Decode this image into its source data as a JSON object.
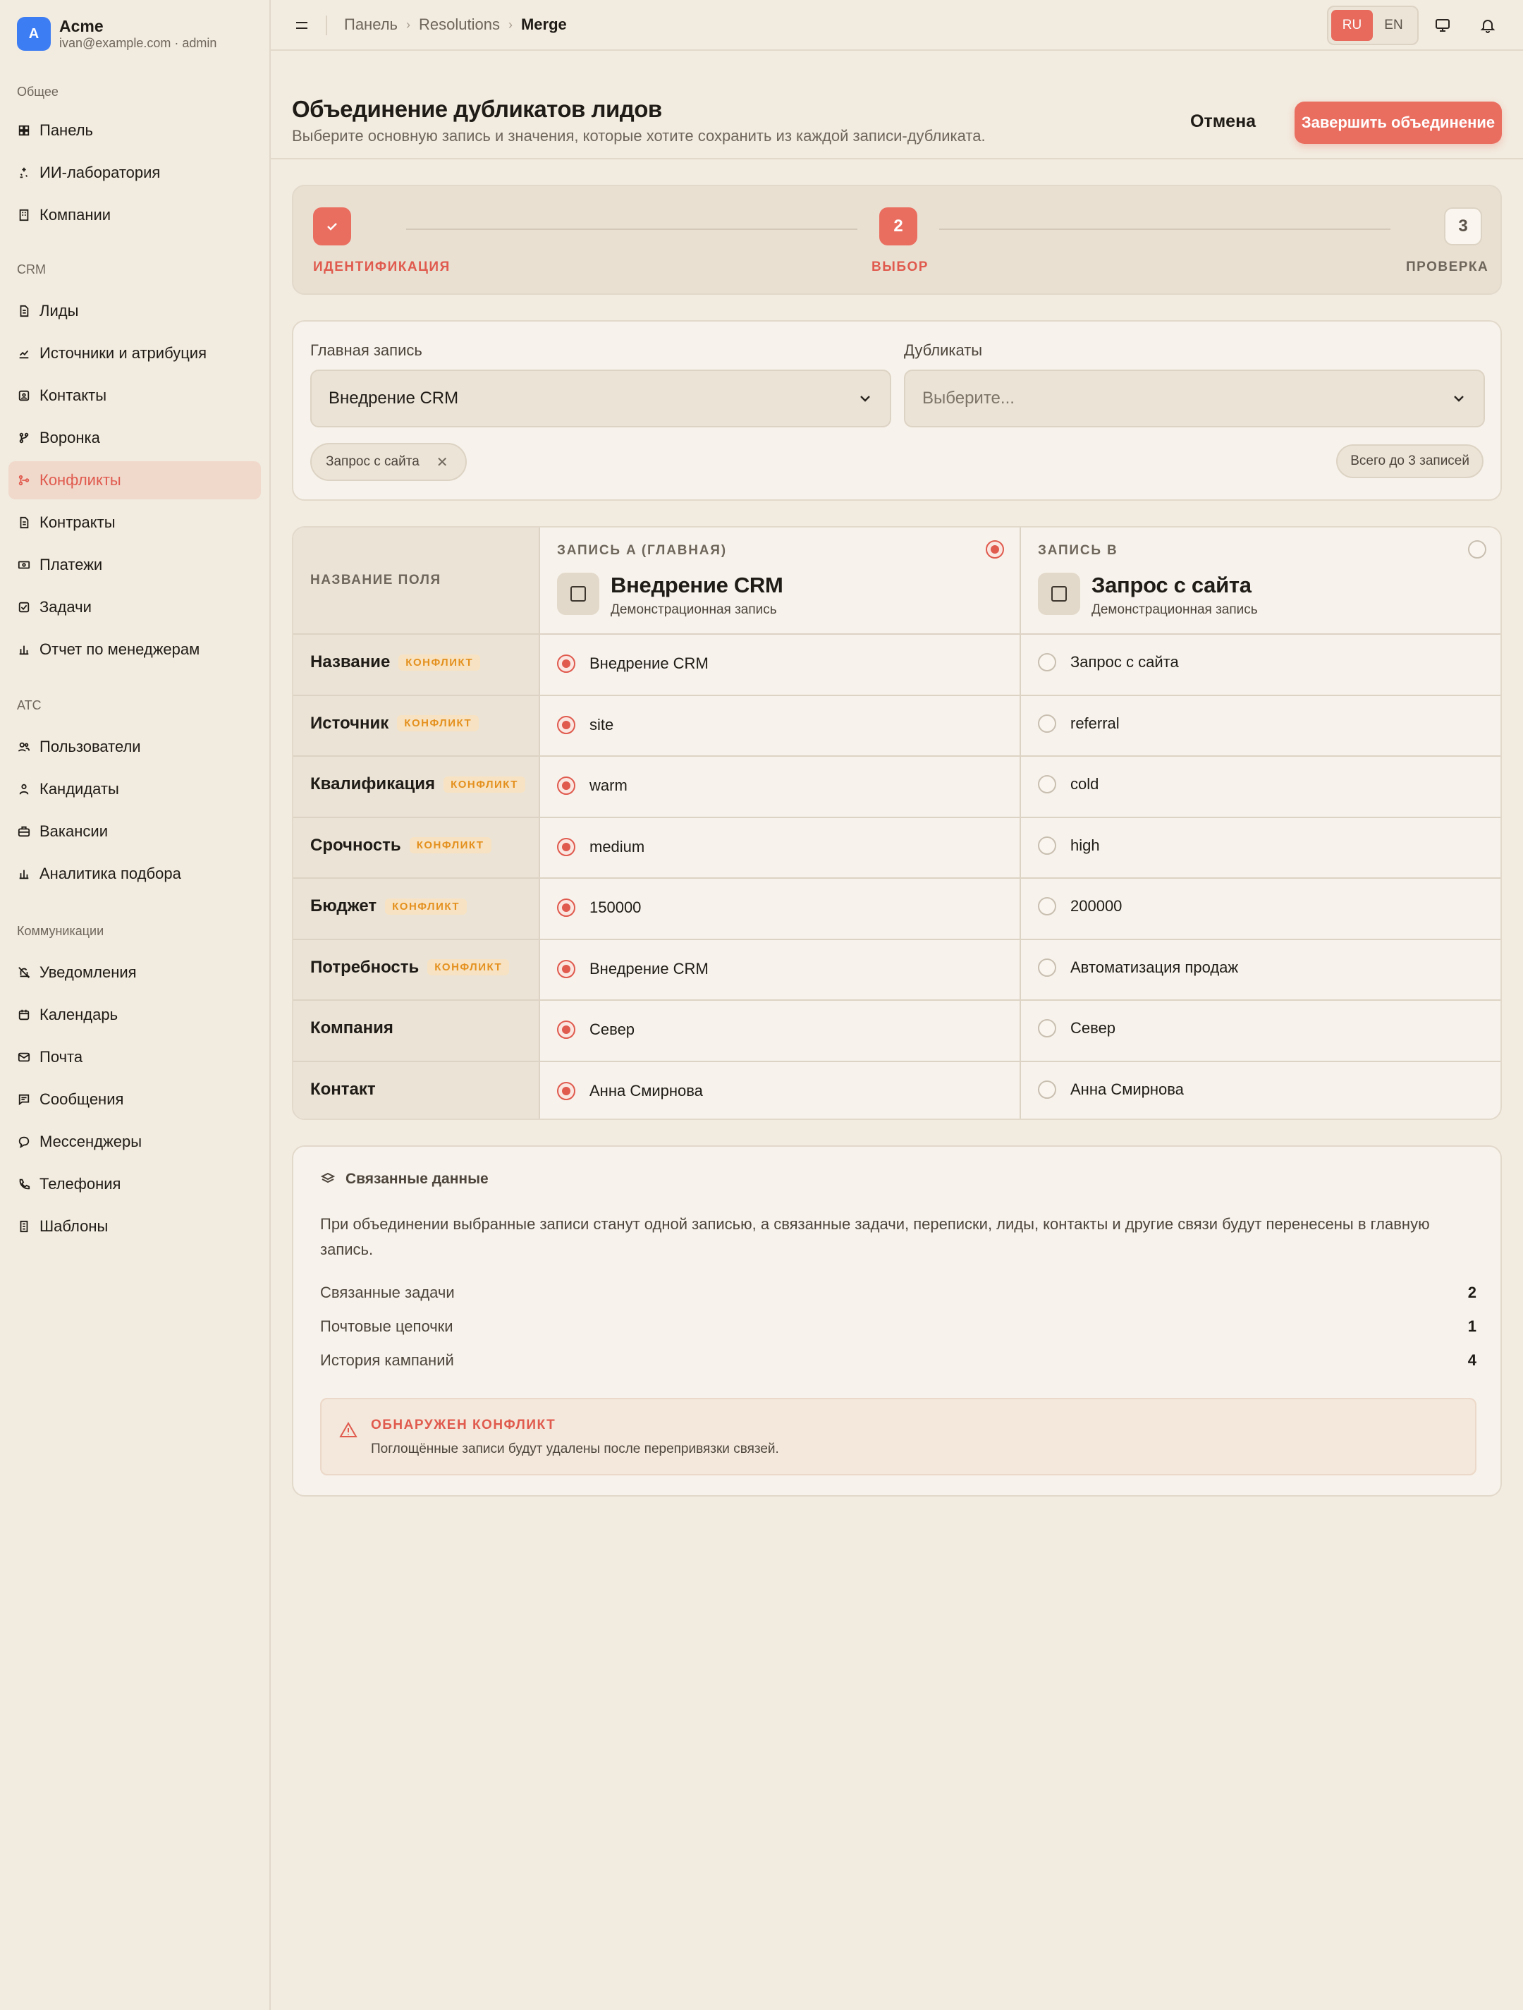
{
  "brand": {
    "logo_letter": "A",
    "name": "Acme",
    "account": "ivan@example.com · admin"
  },
  "sidebar": {
    "sections": [
      {
        "title": "Общее",
        "items": [
          {
            "label": "Панель",
            "icon": "dashboard-icon"
          },
          {
            "label": "ИИ-лаборатория",
            "icon": "sparkles-icon"
          },
          {
            "label": "Компании",
            "icon": "building-icon"
          }
        ]
      },
      {
        "title": "CRM",
        "items": [
          {
            "label": "Лиды",
            "icon": "document-icon"
          },
          {
            "label": "Источники и атрибуция",
            "icon": "chart-line-icon"
          },
          {
            "label": "Контакты",
            "icon": "contact-card-icon"
          },
          {
            "label": "Воронка",
            "icon": "funnel-icon"
          },
          {
            "label": "Конфликты",
            "icon": "merge-icon",
            "active": true
          },
          {
            "label": "Контракты",
            "icon": "document-icon"
          },
          {
            "label": "Платежи",
            "icon": "banknote-icon"
          },
          {
            "label": "Задачи",
            "icon": "checkbox-icon"
          },
          {
            "label": "Отчет по менеджерам",
            "icon": "bar-chart-icon"
          }
        ]
      },
      {
        "title": "ATC",
        "items": [
          {
            "label": "Пользователи",
            "icon": "users-icon"
          },
          {
            "label": "Кандидаты",
            "icon": "user-icon"
          },
          {
            "label": "Вакансии",
            "icon": "briefcase-icon"
          },
          {
            "label": "Аналитика подбора",
            "icon": "bar-chart-icon"
          }
        ]
      },
      {
        "title": "Коммуникации",
        "items": [
          {
            "label": "Уведомления",
            "icon": "bell-off-icon"
          },
          {
            "label": "Календарь",
            "icon": "calendar-icon"
          },
          {
            "label": "Почта",
            "icon": "mail-icon"
          },
          {
            "label": "Сообщения",
            "icon": "message-square-icon"
          },
          {
            "label": "Мессенджеры",
            "icon": "chat-bubble-icon"
          },
          {
            "label": "Телефония",
            "icon": "phone-icon"
          },
          {
            "label": "Шаблоны",
            "icon": "template-icon"
          }
        ]
      }
    ]
  },
  "topbar": {
    "breadcrumb": [
      "Панель",
      "Resolutions",
      "Merge"
    ],
    "languages": [
      {
        "code": "RU",
        "active": true
      },
      {
        "code": "EN",
        "active": false
      }
    ],
    "icons": [
      "monitor-icon",
      "bell-icon"
    ]
  },
  "header": {
    "title": "Объединение дубликатов лидов",
    "subtitle": "Выберите основную запись и значения, которые хотите сохранить из каждой записи-дубликата.",
    "cancel_label": "Отмена",
    "submit_label": "Завершить объединение"
  },
  "stepper": {
    "steps": [
      {
        "label": "ИДЕНТИФИКАЦИЯ",
        "state": "done",
        "number": ""
      },
      {
        "label": "ВЫБОР",
        "state": "current",
        "number": "2"
      },
      {
        "label": "ПРОВЕРКА",
        "state": "todo",
        "number": "3"
      }
    ]
  },
  "selection": {
    "primary_label": "Главная запись",
    "primary_value": "Внедрение CRM",
    "duplicates_label": "Дубликаты",
    "duplicates_placeholder": "Выберите...",
    "chips": [
      "Запрос с сайта"
    ],
    "limit_badge": "Всего до 3 записей"
  },
  "compare": {
    "field_header": "НАЗВАНИЕ ПОЛЯ",
    "conflict_tag": "КОНФЛИКТ",
    "records": [
      {
        "kicker": "ЗАПИСЬ A (ГЛАВНАЯ)",
        "title": "Внедрение CRM",
        "subtitle": "Демонстрационная запись",
        "selected": true
      },
      {
        "kicker": "ЗАПИСЬ B",
        "title": "Запрос с сайта",
        "subtitle": "Демонстрационная запись",
        "selected": false
      }
    ],
    "rows": [
      {
        "field": "Название",
        "conflict": true,
        "a": "Внедрение CRM",
        "b": "Запрос с сайта"
      },
      {
        "field": "Источник",
        "conflict": true,
        "a": "site",
        "b": "referral"
      },
      {
        "field": "Квалификация",
        "conflict": true,
        "a": "warm",
        "b": "cold"
      },
      {
        "field": "Срочность",
        "conflict": true,
        "a": "medium",
        "b": "high"
      },
      {
        "field": "Бюджет",
        "conflict": true,
        "a": "150000",
        "b": "200000"
      },
      {
        "field": "Потребность",
        "conflict": true,
        "a": "Внедрение CRM",
        "b": "Автоматизация продаж"
      },
      {
        "field": "Компания",
        "conflict": false,
        "a": "Север",
        "b": "Север"
      },
      {
        "field": "Контакт",
        "conflict": false,
        "a": "Анна Смирнова",
        "b": "Анна Смирнова"
      }
    ]
  },
  "related": {
    "title": "Связанные данные",
    "description": "При объединении выбранные записи станут одной записью, а связанные задачи, переписки, лиды, контакты и другие связи будут перенесены в главную запись.",
    "stats": [
      {
        "label": "Связанные задачи",
        "value": "2"
      },
      {
        "label": "Почтовые цепочки",
        "value": "1"
      },
      {
        "label": "История кампаний",
        "value": "4"
      }
    ],
    "warning_title": "ОБНАРУЖЕН КОНФЛИКТ",
    "warning_text": "Поглощённые записи будут удалены после перепривязки связей."
  },
  "colors": {
    "accent": "#ea6e60",
    "accent_dark": "#e05a4e",
    "conflict": "#e4901e",
    "background": "#f2ebdf",
    "brand_logo": "#3d7df4"
  }
}
